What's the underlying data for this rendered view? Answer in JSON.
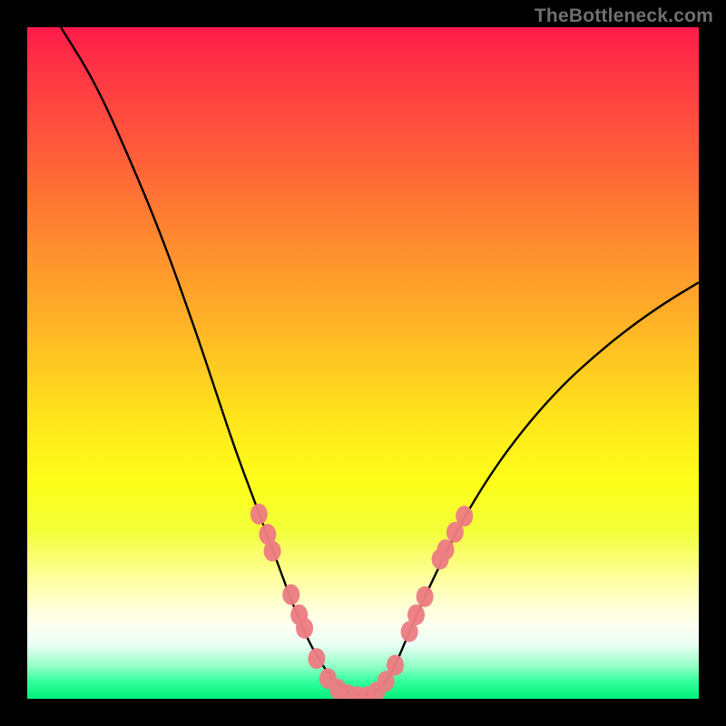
{
  "watermark": "TheBottleneck.com",
  "colors": {
    "frame": "#000000",
    "curve": "#000000",
    "marker": "#ec7d82",
    "gradient_stops": [
      {
        "pos": 0.0,
        "hex": "#ff1a4b"
      },
      {
        "pos": 0.18,
        "hex": "#ff5a3b"
      },
      {
        "pos": 0.45,
        "hex": "#ffb626"
      },
      {
        "pos": 0.68,
        "hex": "#fdff1a"
      },
      {
        "pos": 0.86,
        "hex": "#ffffd4"
      },
      {
        "pos": 0.95,
        "hex": "#97ffc7"
      },
      {
        "pos": 1.0,
        "hex": "#00f07a"
      }
    ]
  },
  "chart_data": {
    "type": "line",
    "title": "",
    "xlabel": "",
    "ylabel": "",
    "xlim": [
      0,
      1
    ],
    "ylim": [
      0,
      1
    ],
    "series": [
      {
        "name": "bottleneck-curve",
        "x": [
          0.05,
          0.1,
          0.15,
          0.2,
          0.25,
          0.28,
          0.31,
          0.34,
          0.37,
          0.39,
          0.41,
          0.43,
          0.45,
          0.47,
          0.49,
          0.51,
          0.53,
          0.546,
          0.565,
          0.6,
          0.65,
          0.7,
          0.75,
          0.8,
          0.85,
          0.9,
          0.95,
          1.0
        ],
        "y": [
          1.0,
          0.92,
          0.81,
          0.69,
          0.55,
          0.46,
          0.37,
          0.29,
          0.21,
          0.155,
          0.105,
          0.065,
          0.035,
          0.015,
          0.005,
          0.005,
          0.02,
          0.045,
          0.09,
          0.17,
          0.27,
          0.35,
          0.415,
          0.47,
          0.515,
          0.555,
          0.59,
          0.62
        ]
      }
    ],
    "markers": [
      {
        "x": 0.345,
        "y": 0.275
      },
      {
        "x": 0.358,
        "y": 0.245
      },
      {
        "x": 0.365,
        "y": 0.22
      },
      {
        "x": 0.393,
        "y": 0.155
      },
      {
        "x": 0.405,
        "y": 0.125
      },
      {
        "x": 0.413,
        "y": 0.105
      },
      {
        "x": 0.431,
        "y": 0.06
      },
      {
        "x": 0.448,
        "y": 0.03
      },
      {
        "x": 0.463,
        "y": 0.014
      },
      {
        "x": 0.478,
        "y": 0.006
      },
      {
        "x": 0.492,
        "y": 0.003
      },
      {
        "x": 0.506,
        "y": 0.003
      },
      {
        "x": 0.52,
        "y": 0.01
      },
      {
        "x": 0.534,
        "y": 0.026
      },
      {
        "x": 0.548,
        "y": 0.05
      },
      {
        "x": 0.569,
        "y": 0.1
      },
      {
        "x": 0.579,
        "y": 0.125
      },
      {
        "x": 0.592,
        "y": 0.152
      },
      {
        "x": 0.615,
        "y": 0.208
      },
      {
        "x": 0.623,
        "y": 0.222
      },
      {
        "x": 0.637,
        "y": 0.248
      },
      {
        "x": 0.651,
        "y": 0.272
      }
    ]
  }
}
